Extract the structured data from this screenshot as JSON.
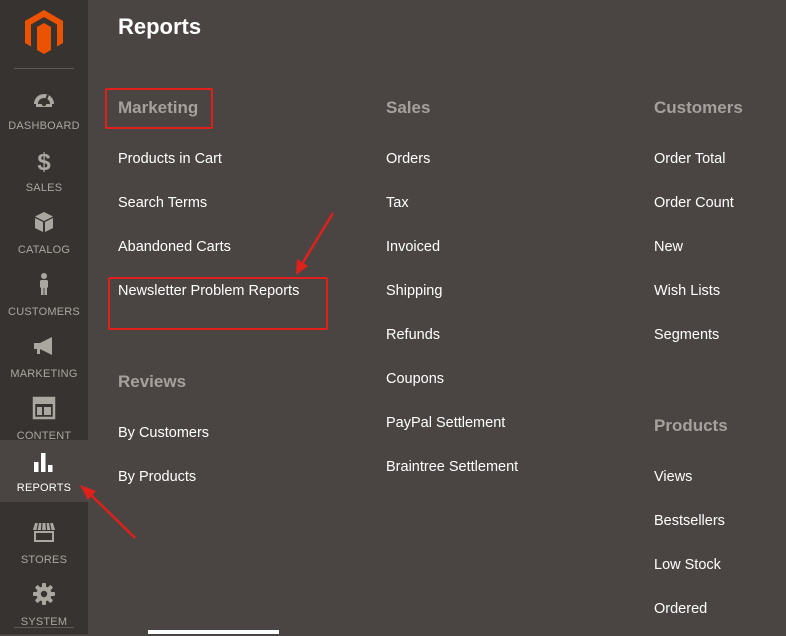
{
  "sidebar": {
    "items": [
      {
        "label": "DASHBOARD",
        "icon": "dashboard-icon"
      },
      {
        "label": "SALES",
        "icon": "dollar-icon"
      },
      {
        "label": "CATALOG",
        "icon": "cube-icon"
      },
      {
        "label": "CUSTOMERS",
        "icon": "person-icon"
      },
      {
        "label": "MARKETING",
        "icon": "megaphone-icon"
      },
      {
        "label": "CONTENT",
        "icon": "layout-icon"
      },
      {
        "label": "REPORTS",
        "icon": "bar-chart-icon",
        "active": true
      },
      {
        "label": "STORES",
        "icon": "store-icon"
      },
      {
        "label": "SYSTEM",
        "icon": "gear-icon"
      }
    ]
  },
  "panel": {
    "title": "Reports",
    "sections": {
      "marketing": {
        "title": "Marketing",
        "items": [
          "Products in Cart",
          "Search Terms",
          "Abandoned Carts",
          "Newsletter Problem Reports"
        ]
      },
      "reviews": {
        "title": "Reviews",
        "items": [
          "By Customers",
          "By Products"
        ]
      },
      "sales": {
        "title": "Sales",
        "items": [
          "Orders",
          "Tax",
          "Invoiced",
          "Shipping",
          "Refunds",
          "Coupons",
          "PayPal Settlement",
          "Braintree Settlement"
        ]
      },
      "customers": {
        "title": "Customers",
        "items": [
          "Order Total",
          "Order Count",
          "New",
          "Wish Lists",
          "Segments"
        ]
      },
      "products": {
        "title": "Products",
        "items": [
          "Views",
          "Bestsellers",
          "Low Stock",
          "Ordered"
        ]
      }
    }
  },
  "colors": {
    "sidebar_bg": "#373330",
    "panel_bg": "#4a4542",
    "logo": "#eb5202",
    "annotation": "#e0201a"
  }
}
